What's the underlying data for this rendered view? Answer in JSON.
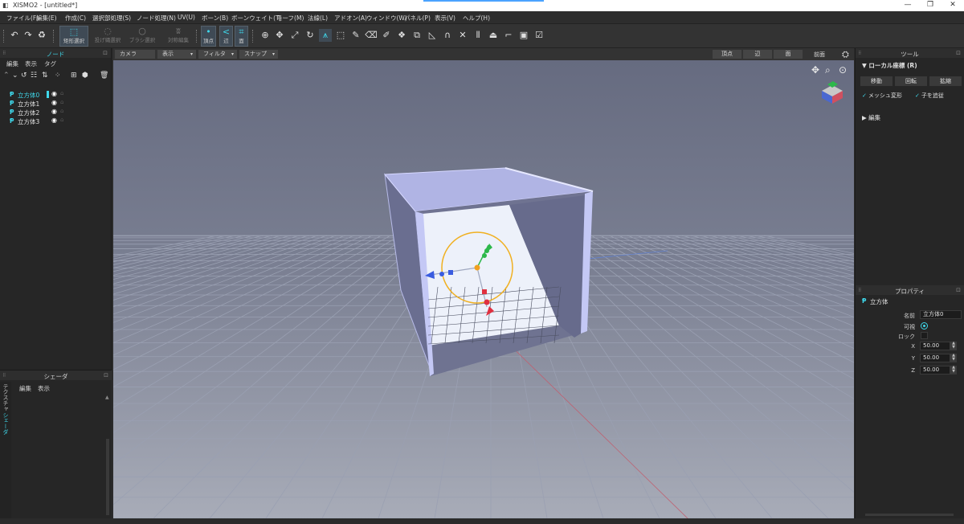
{
  "titlebar": {
    "title": "XISMO2 - [untitled*]",
    "minimize": "—",
    "maximize": "❐",
    "close": "✕"
  },
  "menu": [
    "ファイル(F)",
    "編集(E)",
    "作成(C)",
    "選択部処理(S)",
    "ノード処理(N)",
    "UV(U)",
    "ボーン(B)",
    "ボーンウェイト(T)",
    "モーフ(M)",
    "法線(L)",
    "アドオン(A)",
    "ウィンドウ(W)",
    "パネル(P)",
    "表示(V)",
    "ヘルプ(H)"
  ],
  "toolbar": {
    "select_modes": [
      "矩形選択",
      "投げ縄選択",
      "ブラシ選択",
      "対称編集"
    ],
    "element_modes": [
      "頂点",
      "辺",
      "面"
    ]
  },
  "node_panel": {
    "title": "ノード",
    "menu": [
      "編集",
      "表示",
      "タグ"
    ],
    "items": [
      {
        "label": "立方体0",
        "selected": true
      },
      {
        "label": "立方体1",
        "selected": false
      },
      {
        "label": "立方体2",
        "selected": false
      },
      {
        "label": "立方体3",
        "selected": false
      }
    ]
  },
  "shader_panel": {
    "title": "シェーダ",
    "menu": [
      "編集",
      "表示"
    ],
    "side_tabs": [
      "テクスチャ",
      "シェーダ"
    ]
  },
  "viewport": {
    "dropdowns": [
      "カメラ",
      "表示",
      "フィルタ",
      "スナップ"
    ],
    "view_buttons": [
      "頂点",
      "辺",
      "面"
    ],
    "view_name": "前面"
  },
  "tool_panel": {
    "title": "ツール",
    "local_coords": "ローカル座標 (R)",
    "buttons": [
      "移動",
      "回転",
      "拡縮"
    ],
    "mesh_deform": "メッシュ変形",
    "follow_children": "子を追従",
    "edit_section": "編集"
  },
  "props_panel": {
    "title": "プロパティ",
    "object_type": "立方体",
    "name_label": "名前",
    "name_value": "立方体0",
    "visible_label": "可視",
    "lock_label": "ロック",
    "x_label": "X",
    "x_value": "50.00",
    "y_label": "Y",
    "y_value": "50.00",
    "z_label": "Z",
    "z_value": "50.00"
  },
  "colors": {
    "accent": "#3fd7ea",
    "axis_green": "#2db84a",
    "axis_blue": "#3a5ce0",
    "axis_red": "#e03040",
    "gizmo_ring": "#f0b020"
  }
}
